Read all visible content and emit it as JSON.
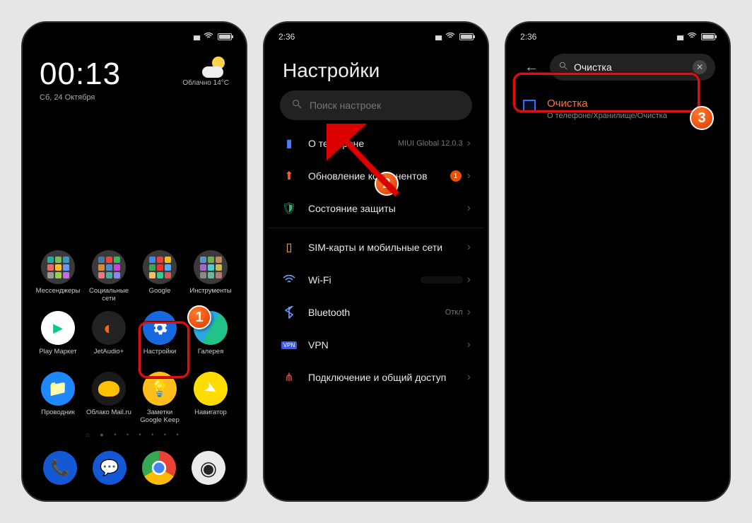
{
  "phone1": {
    "time": "00:13",
    "date": "Сб, 24 Октября",
    "weather_text": "Облачно  14°C",
    "folders": [
      {
        "label": "Мессенджеры"
      },
      {
        "label": "Социальные сети"
      },
      {
        "label": "Google"
      },
      {
        "label": "Инструменты"
      }
    ],
    "apps_row2": [
      {
        "label": "Play Маркет"
      },
      {
        "label": "JetAudio+"
      },
      {
        "label": "Настройки"
      },
      {
        "label": "Галерея"
      }
    ],
    "apps_row3": [
      {
        "label": "Проводник"
      },
      {
        "label": "Облако Mail.ru"
      },
      {
        "label": "Заметки Google Keep"
      },
      {
        "label": "Навигатор"
      }
    ]
  },
  "phone2": {
    "status_time": "2:36",
    "title": "Настройки",
    "search_placeholder": "Поиск настроек",
    "items": [
      {
        "label": "О телефоне",
        "side": "MIUI Global 12.0.3"
      },
      {
        "label": "Обновление компонентов",
        "badge": "1"
      },
      {
        "label": "Состояние защиты"
      },
      {
        "label": "SIM-карты и мобильные сети"
      },
      {
        "label": "Wi-Fi",
        "side": ""
      },
      {
        "label": "Bluetooth",
        "side": "Откл"
      },
      {
        "label": "VPN"
      },
      {
        "label": "Подключение и общий доступ"
      }
    ]
  },
  "phone3": {
    "status_time": "2:36",
    "search_value": "Очистка",
    "result_title": "Очистка",
    "result_path": "О телефоне/Хранилище/Очистка"
  },
  "steps": {
    "s1": "1",
    "s2": "2",
    "s3": "3"
  }
}
